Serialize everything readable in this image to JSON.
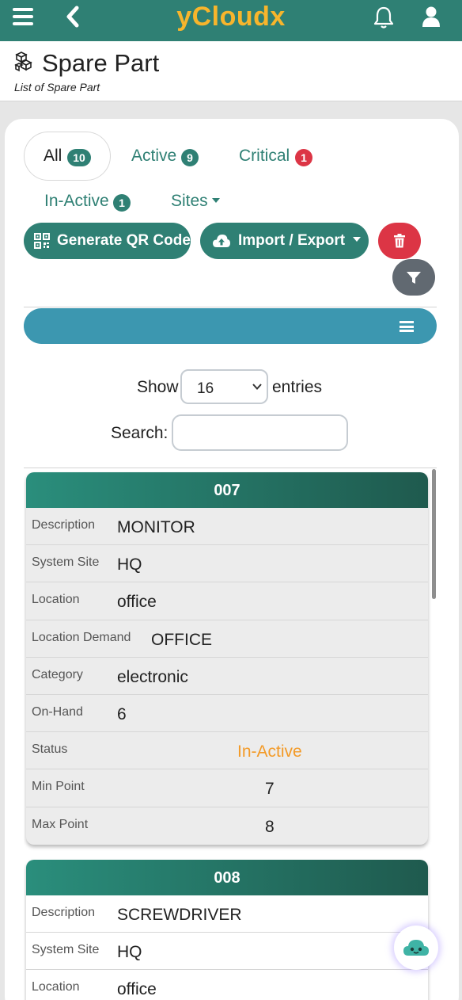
{
  "app": {
    "brand": "yCloudx",
    "menu_icon": "hamburger-icon",
    "back_icon": "chevron-left-icon",
    "bell_icon": "bell-icon",
    "user_icon": "user-icon"
  },
  "page": {
    "title": "Spare Part",
    "subtitle": "List of Spare Part",
    "icon": "boxes-icon"
  },
  "tabs": {
    "all": {
      "label": "All",
      "count": "10"
    },
    "active": {
      "label": "Active",
      "count": "9"
    },
    "critical": {
      "label": "Critical",
      "count": "1"
    },
    "inactive": {
      "label": "In-Active",
      "count": "1"
    },
    "sites": {
      "label": "Sites"
    }
  },
  "actions": {
    "qr": "Generate QR Code",
    "import_export": "Import / Export",
    "delete_icon": "trash-icon",
    "filter_icon": "filter-icon"
  },
  "table_controls": {
    "show_label": "Show",
    "entries_value": "16",
    "entries_label": "entries",
    "search_label": "Search:",
    "search_value": ""
  },
  "labels": {
    "description": "Description",
    "system_site": "System Site",
    "location": "Location",
    "location_demand": "Location Demand",
    "category": "Category",
    "on_hand": "On-Hand",
    "status": "Status",
    "min_point": "Min Point",
    "max_point": "Max Point"
  },
  "records": [
    {
      "code": "007",
      "description": "MONITOR",
      "system_site": "HQ",
      "location": "office",
      "location_demand": "OFFICE",
      "category": "electronic",
      "on_hand": "6",
      "status": "In-Active",
      "min_point": "7",
      "max_point": "8"
    },
    {
      "code": "008",
      "description": "SCREWDRIVER",
      "system_site": "HQ",
      "location": "office"
    }
  ],
  "colors": {
    "primary": "#2f8074",
    "brand": "#f7b52c",
    "danger": "#dc3545",
    "info": "#3c97b0",
    "status_inactive": "#f39a27"
  },
  "assistant_icon": "cloud-bot-icon"
}
